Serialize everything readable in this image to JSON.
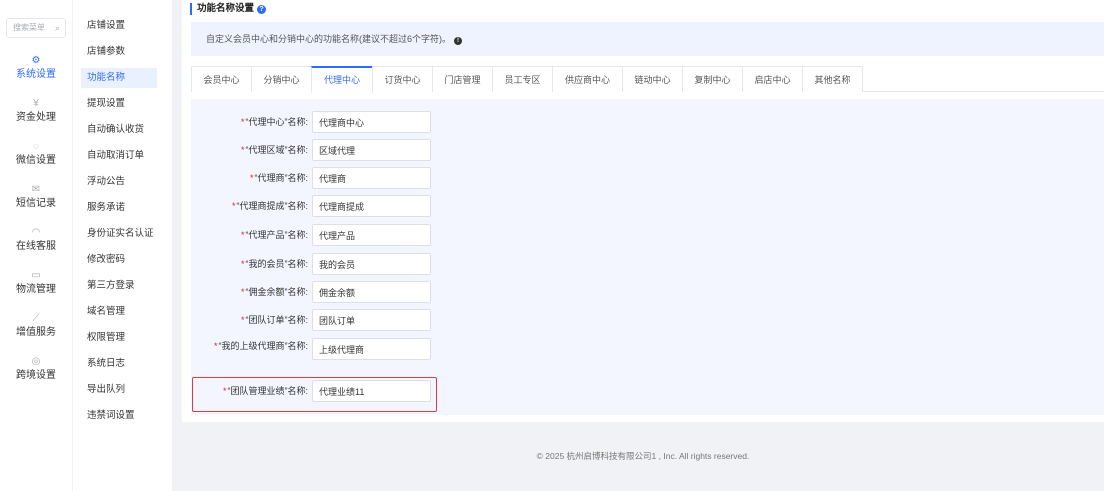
{
  "rail": {
    "search_placeholder": "搜索菜单",
    "items": [
      {
        "label": "系统设置",
        "icon": "gear-icon",
        "glyph": "⚙",
        "active": true
      },
      {
        "label": "资金处理",
        "icon": "money-icon",
        "glyph": "¥"
      },
      {
        "label": "微信设置",
        "icon": "wechat-icon",
        "glyph": "◌"
      },
      {
        "label": "短信记录",
        "icon": "mail-icon",
        "glyph": "✉"
      },
      {
        "label": "在线客服",
        "icon": "headset-icon",
        "glyph": "◠"
      },
      {
        "label": "物流管理",
        "icon": "truck-icon",
        "glyph": "▭"
      },
      {
        "label": "增值服务",
        "icon": "chart-icon",
        "glyph": "⟋"
      },
      {
        "label": "跨境设置",
        "icon": "globe-icon",
        "glyph": "◎"
      }
    ]
  },
  "submenu": {
    "items": [
      {
        "label": "店铺设置"
      },
      {
        "label": "店铺参数"
      },
      {
        "label": "功能名称",
        "active": true
      },
      {
        "label": "提现设置"
      },
      {
        "label": "自动确认收货"
      },
      {
        "label": "自动取消订单"
      },
      {
        "label": "浮动公告"
      },
      {
        "label": "服务承诺"
      },
      {
        "label": "身份证实名认证"
      },
      {
        "label": "修改密码"
      },
      {
        "label": "第三方登录"
      },
      {
        "label": "域名管理"
      },
      {
        "label": "权限管理"
      },
      {
        "label": "系统日志"
      },
      {
        "label": "导出队列"
      },
      {
        "label": "违禁词设置"
      }
    ]
  },
  "main": {
    "section_title": "功能名称设置",
    "help_glyph": "?",
    "notice": "自定义会员中心和分销中心的功能名称(建议不超过6个字符)。",
    "notice_icon_glyph": "!",
    "tabs": [
      {
        "label": "会员中心"
      },
      {
        "label": "分销中心"
      },
      {
        "label": "代理中心",
        "active": true
      },
      {
        "label": "订货中心"
      },
      {
        "label": "门店管理"
      },
      {
        "label": "员工专区"
      },
      {
        "label": "供应商中心"
      },
      {
        "label": "链动中心"
      },
      {
        "label": "复制中心"
      },
      {
        "label": "启店中心"
      },
      {
        "label": "其他名称"
      }
    ],
    "required_mark": "*",
    "fields": [
      {
        "label": "“代理中心”名称:",
        "value": "代理商中心"
      },
      {
        "label": "“代理区域”名称:",
        "value": "区域代理"
      },
      {
        "label": "“代理商”名称:",
        "value": "代理商"
      },
      {
        "label": "“代理商提成”名称:",
        "value": "代理商提成"
      },
      {
        "label": "“代理产品”名称:",
        "value": "代理产品"
      },
      {
        "label": "“我的会员”名称:",
        "value": "我的会员"
      },
      {
        "label": "“佣金余额”名称:",
        "value": "佣金余额"
      },
      {
        "label": "“团队订单”名称:",
        "value": "团队订单"
      },
      {
        "label": "“我的上级代理商”名称:",
        "value": "上级代理商"
      },
      {
        "label": "“团队管理业绩”名称:",
        "value": "代理业绩11"
      }
    ]
  },
  "footer": {
    "copyright": "© 2025 杭州启博科技有限公司1 , Inc. All rights reserved."
  },
  "colors": {
    "accent": "#2d6cf6",
    "required": "#e02020",
    "highlight_box": "#e53935"
  }
}
